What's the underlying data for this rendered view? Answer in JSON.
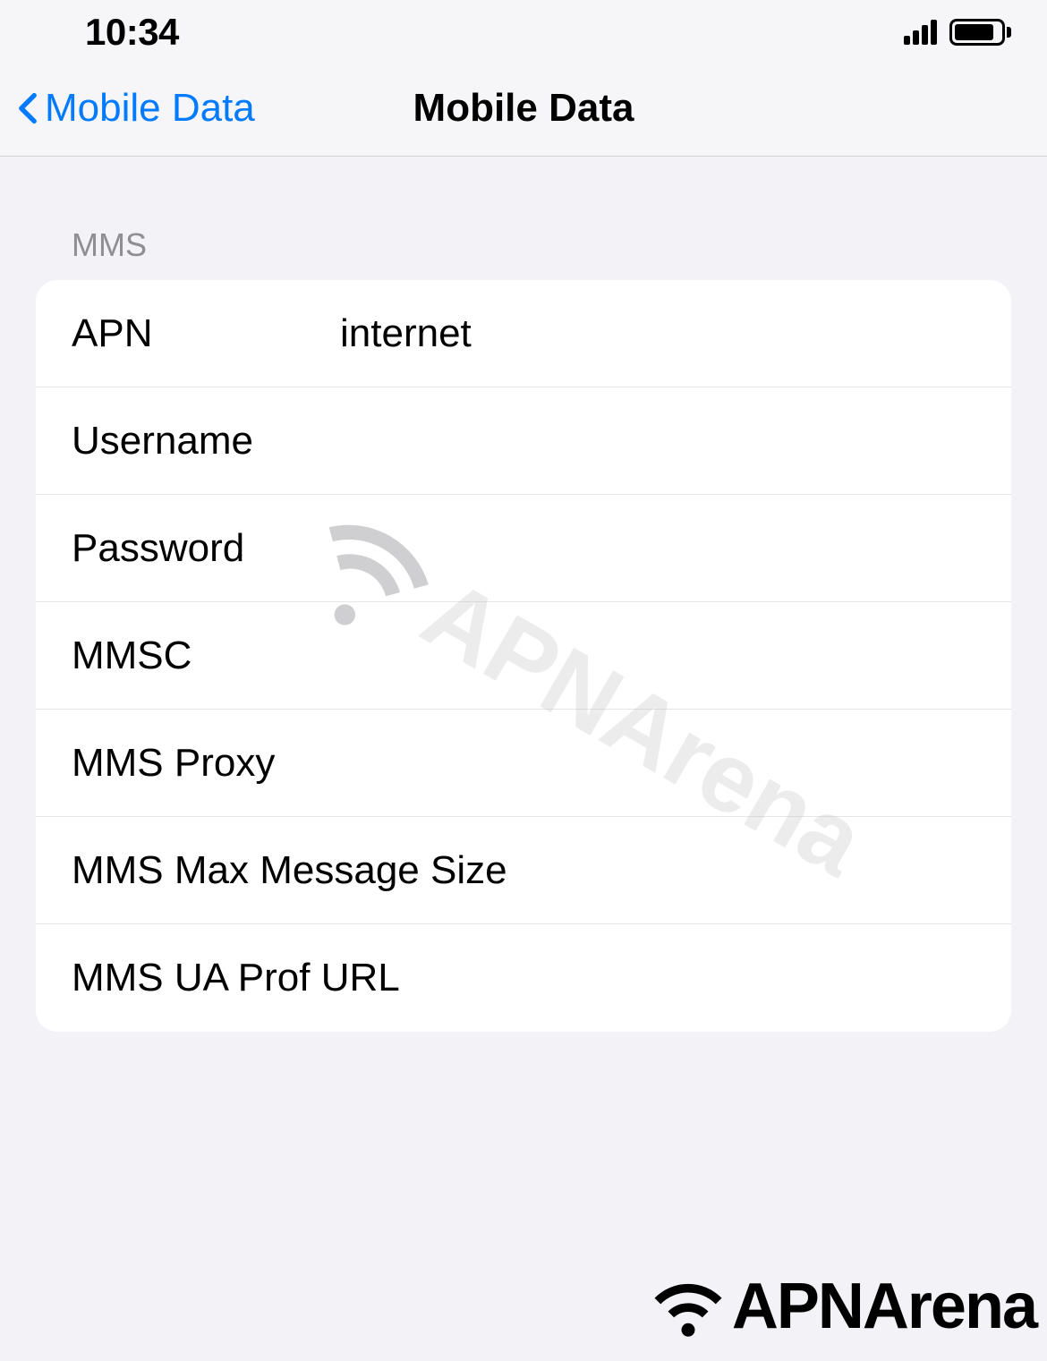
{
  "status": {
    "time": "10:34"
  },
  "nav": {
    "back_label": "Mobile Data",
    "title": "Mobile Data"
  },
  "section": {
    "header": "MMS",
    "rows": [
      {
        "label": "APN",
        "value": "internet"
      },
      {
        "label": "Username",
        "value": ""
      },
      {
        "label": "Password",
        "value": ""
      },
      {
        "label": "MMSC",
        "value": ""
      },
      {
        "label": "MMS Proxy",
        "value": ""
      },
      {
        "label": "MMS Max Message Size",
        "value": ""
      },
      {
        "label": "MMS UA Prof URL",
        "value": ""
      }
    ]
  },
  "watermark": "APNArena",
  "footer_logo": "APNArena"
}
